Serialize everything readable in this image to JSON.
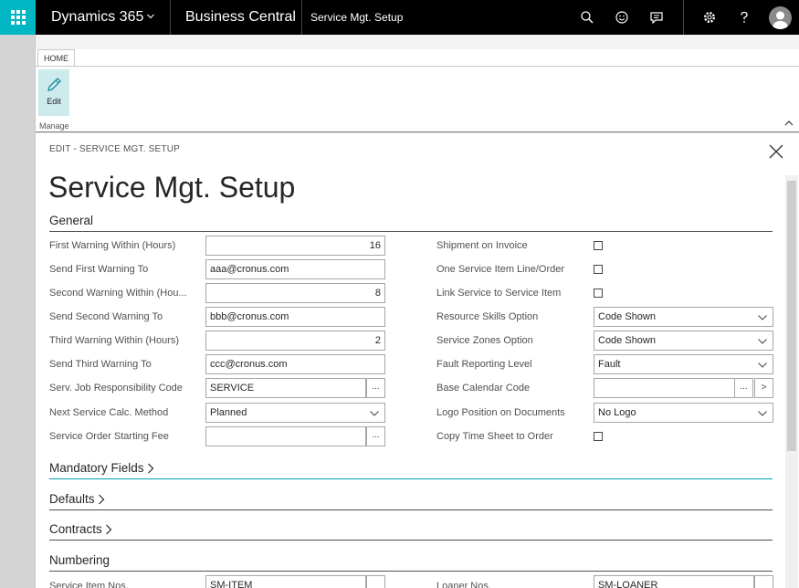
{
  "topbar": {
    "app_name": "Dynamics 365",
    "product": "Business Central",
    "breadcrumb": "Service Mgt. Setup",
    "icons": [
      "search-icon",
      "smile-icon",
      "chat-icon",
      "gear-icon",
      "help-icon",
      "user-avatar"
    ]
  },
  "ribbon": {
    "tab": "HOME",
    "edit_label": "Edit",
    "group_label": "Manage"
  },
  "card": {
    "header": "EDIT - SERVICE MGT. SETUP",
    "title": "Service Mgt. Setup"
  },
  "sections": {
    "general": "General",
    "mandatory": "Mandatory Fields",
    "defaults": "Defaults",
    "contracts": "Contracts",
    "numbering": "Numbering"
  },
  "general_left": [
    {
      "label": "First Warning Within (Hours)",
      "value": "16"
    },
    {
      "label": "Send First Warning To",
      "value": "aaa@cronus.com"
    },
    {
      "label": "Second Warning Within (Hou...",
      "value": "8"
    },
    {
      "label": "Send Second Warning To",
      "value": "bbb@cronus.com"
    },
    {
      "label": "Third Warning Within (Hours)",
      "value": "2"
    },
    {
      "label": "Send Third Warning To",
      "value": "ccc@cronus.com"
    },
    {
      "label": "Serv. Job Responsibility Code",
      "value": "SERVICE"
    },
    {
      "label": "Next Service Calc. Method",
      "value": "Planned"
    },
    {
      "label": "Service Order Starting Fee",
      "value": ""
    }
  ],
  "general_right": [
    {
      "label": "Shipment on Invoice",
      "checked": false
    },
    {
      "label": "One Service Item Line/Order",
      "checked": false
    },
    {
      "label": "Link Service to Service Item",
      "checked": false
    },
    {
      "label": "Resource Skills Option",
      "value": "Code Shown"
    },
    {
      "label": "Service Zones Option",
      "value": "Code Shown"
    },
    {
      "label": "Fault Reporting Level",
      "value": "Fault"
    },
    {
      "label": "Base Calendar Code",
      "value": ""
    },
    {
      "label": "Logo Position on Documents",
      "value": "No Logo"
    },
    {
      "label": "Copy Time Sheet to Order",
      "checked": false
    }
  ],
  "numbering": {
    "left_label": "Service Item Nos.",
    "left_value": "SM-ITEM",
    "right_label": "Loaner Nos.",
    "right_value": "SM-LOANER"
  },
  "lookup_glyph": "...",
  "next_glyph": ">"
}
